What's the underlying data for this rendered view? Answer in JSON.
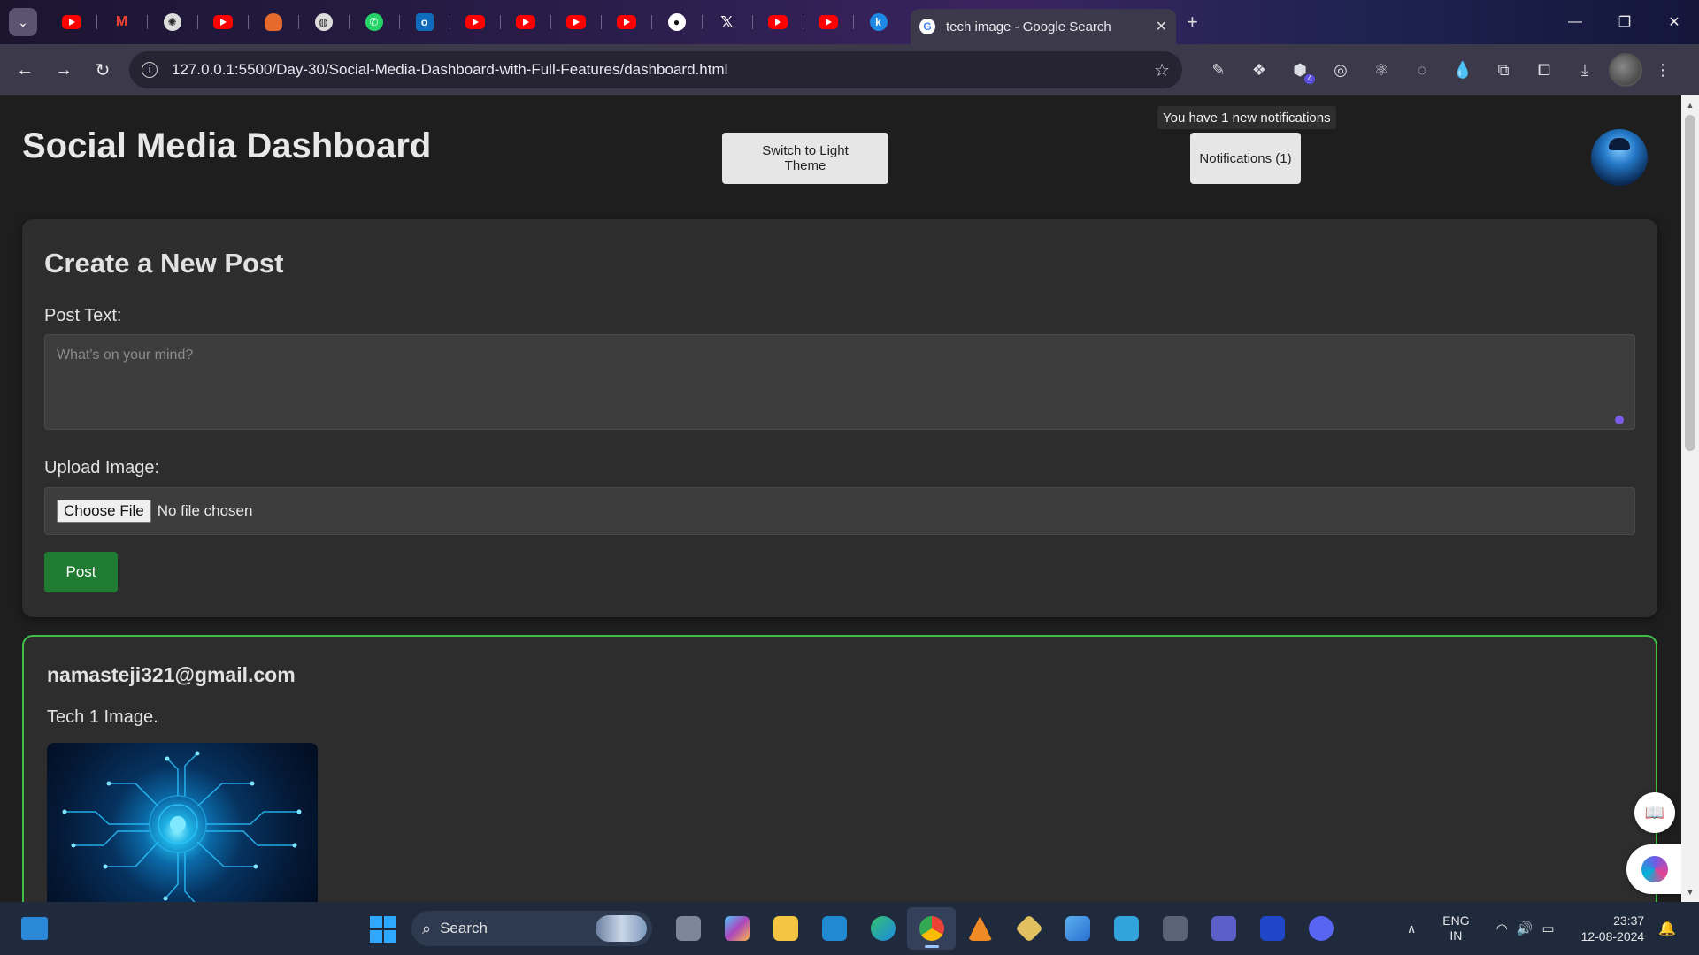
{
  "browser": {
    "active_tab_title": "tech image - Google Search",
    "address": "127.0.0.1:5500/Day-30/Social-Media-Dashboard-with-Full-Features/dashboard.html",
    "extension_badge": "4",
    "pinned_tabs": [
      "youtube",
      "gmail",
      "openai",
      "youtube",
      "postman",
      "web",
      "whatsapp",
      "outlook",
      "youtube",
      "youtube",
      "youtube",
      "youtube",
      "github",
      "x",
      "youtube",
      "youtube",
      "kaggle"
    ]
  },
  "dashboard": {
    "title": "Social Media Dashboard",
    "theme_button": "Switch to Light Theme",
    "notifications_tooltip": "You have 1 new notifications",
    "notifications_button": "Notifications (1)"
  },
  "create_post": {
    "heading": "Create a New Post",
    "text_label": "Post Text:",
    "text_placeholder": "What's on your mind?",
    "upload_label": "Upload Image:",
    "choose_file": "Choose File",
    "file_status": "No file chosen",
    "submit": "Post"
  },
  "post": {
    "author": "namasteji321@gmail.com",
    "text": "Tech 1 Image."
  },
  "taskbar": {
    "search_label": "Search",
    "lang_primary": "ENG",
    "lang_region": "IN",
    "time": "23:37",
    "date": "12-08-2024"
  },
  "colors": {
    "accent_post_button": "#1f7a32",
    "post_card_border": "#3fbf4a",
    "page_background": "#1e1e1e",
    "card_background": "#2d2d2d"
  }
}
